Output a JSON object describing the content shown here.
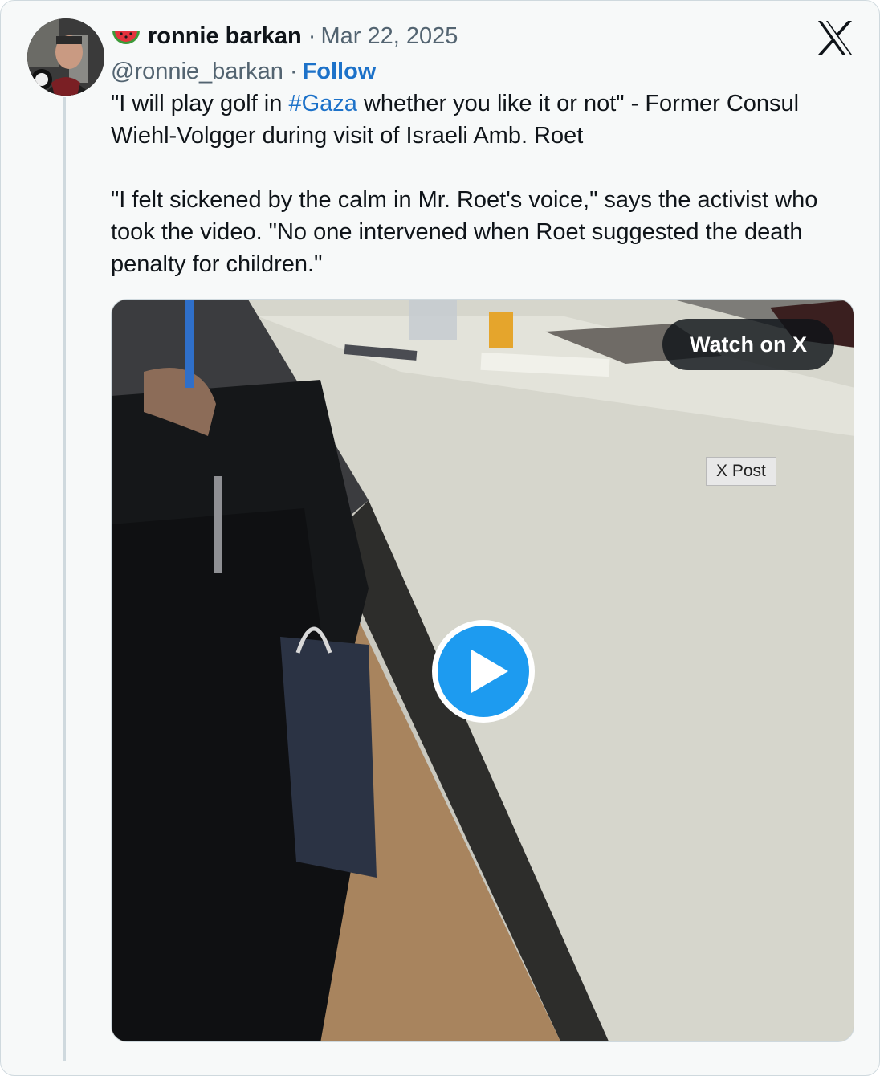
{
  "post": {
    "author_name": "ronnie barkan",
    "separator": "·",
    "date": "Mar 22, 2025",
    "handle": "@ronnie_barkan",
    "follow_label": "Follow",
    "paragraph1_before": "\"I will play golf in ",
    "hashtag": "#Gaza",
    "paragraph1_after": " whether you like it or not\" - Former Consul Wiehl-Volgger during visit of Israeli Amb. Roet",
    "paragraph2": "\"I felt sickened by the calm in Mr. Roet's voice,\" says the activist who took the video. \"No one intervened when Roet suggested the death penalty for children.\""
  },
  "media": {
    "watch_label": "Watch on X",
    "tag_label": "X Post"
  },
  "icons": {
    "emoji": "watermelon-icon",
    "brand": "x-logo-icon",
    "play": "play-icon"
  },
  "colors": {
    "link": "#1d72c9",
    "play": "#1d9bf0",
    "text": "#0f1419",
    "muted": "#536471"
  }
}
